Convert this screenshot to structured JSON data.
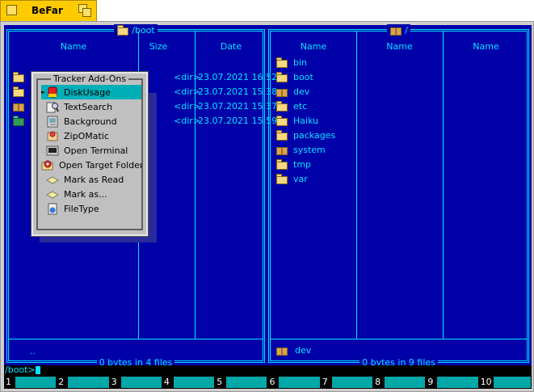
{
  "window": {
    "title": "BeFar"
  },
  "left_panel": {
    "path": "/boot",
    "columns": [
      "Name",
      "Size",
      "Date"
    ],
    "rows": [
      {
        "icon": "folder-icon",
        "size": "<dir>",
        "date": "23.07.2021 16:52"
      },
      {
        "icon": "folder-icon",
        "size": "<dir>",
        "date": "23.07.2021 15:38"
      },
      {
        "icon": "package-box-icon",
        "size": "<dir>",
        "date": "23.07.2021 15:37"
      },
      {
        "icon": "green-package-icon",
        "size": "<dir>",
        "date": "23.07.2021 15:59"
      }
    ],
    "status_name": "..",
    "footer": "0 bytes in 4 files"
  },
  "right_panel": {
    "path": "/",
    "columns": [
      "Name",
      "Name",
      "Name"
    ],
    "rows": [
      {
        "name": "bin",
        "icon": "folder-icon"
      },
      {
        "name": "boot",
        "icon": "folder-icon"
      },
      {
        "name": "dev",
        "icon": "box-icon"
      },
      {
        "name": "etc",
        "icon": "folder-icon"
      },
      {
        "name": "Haiku",
        "icon": "folder-icon"
      },
      {
        "name": "packages",
        "icon": "folder-icon"
      },
      {
        "name": "system",
        "icon": "box-icon"
      },
      {
        "name": "tmp",
        "icon": "folder-icon"
      },
      {
        "name": "var",
        "icon": "folder-icon"
      }
    ],
    "status_name": "dev",
    "footer": "0 bytes in 9 files"
  },
  "menu": {
    "title": "Tracker Add-Ons",
    "items": [
      {
        "label": "DiskUsage",
        "icon": "disk-usage-icon"
      },
      {
        "label": "TextSearch",
        "icon": "text-search-icon"
      },
      {
        "label": "Background",
        "icon": "background-icon"
      },
      {
        "label": "ZipOMatic",
        "icon": "zip-icon"
      },
      {
        "label": "Open Terminal",
        "icon": "terminal-icon"
      },
      {
        "label": "Open Target Folder",
        "icon": "target-folder-icon"
      },
      {
        "label": "Mark as Read",
        "icon": "mail-read-icon"
      },
      {
        "label": "Mark as...",
        "icon": "mail-mark-icon"
      },
      {
        "label": "FileType",
        "icon": "filetype-icon"
      }
    ]
  },
  "command_line": {
    "prompt": "/boot>"
  },
  "fkeys": [
    "1",
    "2",
    "3",
    "4",
    "5",
    "6",
    "7",
    "8",
    "9",
    "10"
  ],
  "colors": {
    "panel_bg": "#0000a8",
    "panel_fg": "#00e5ff",
    "selection": "#00aeb8",
    "tab": "#ffcb00"
  }
}
